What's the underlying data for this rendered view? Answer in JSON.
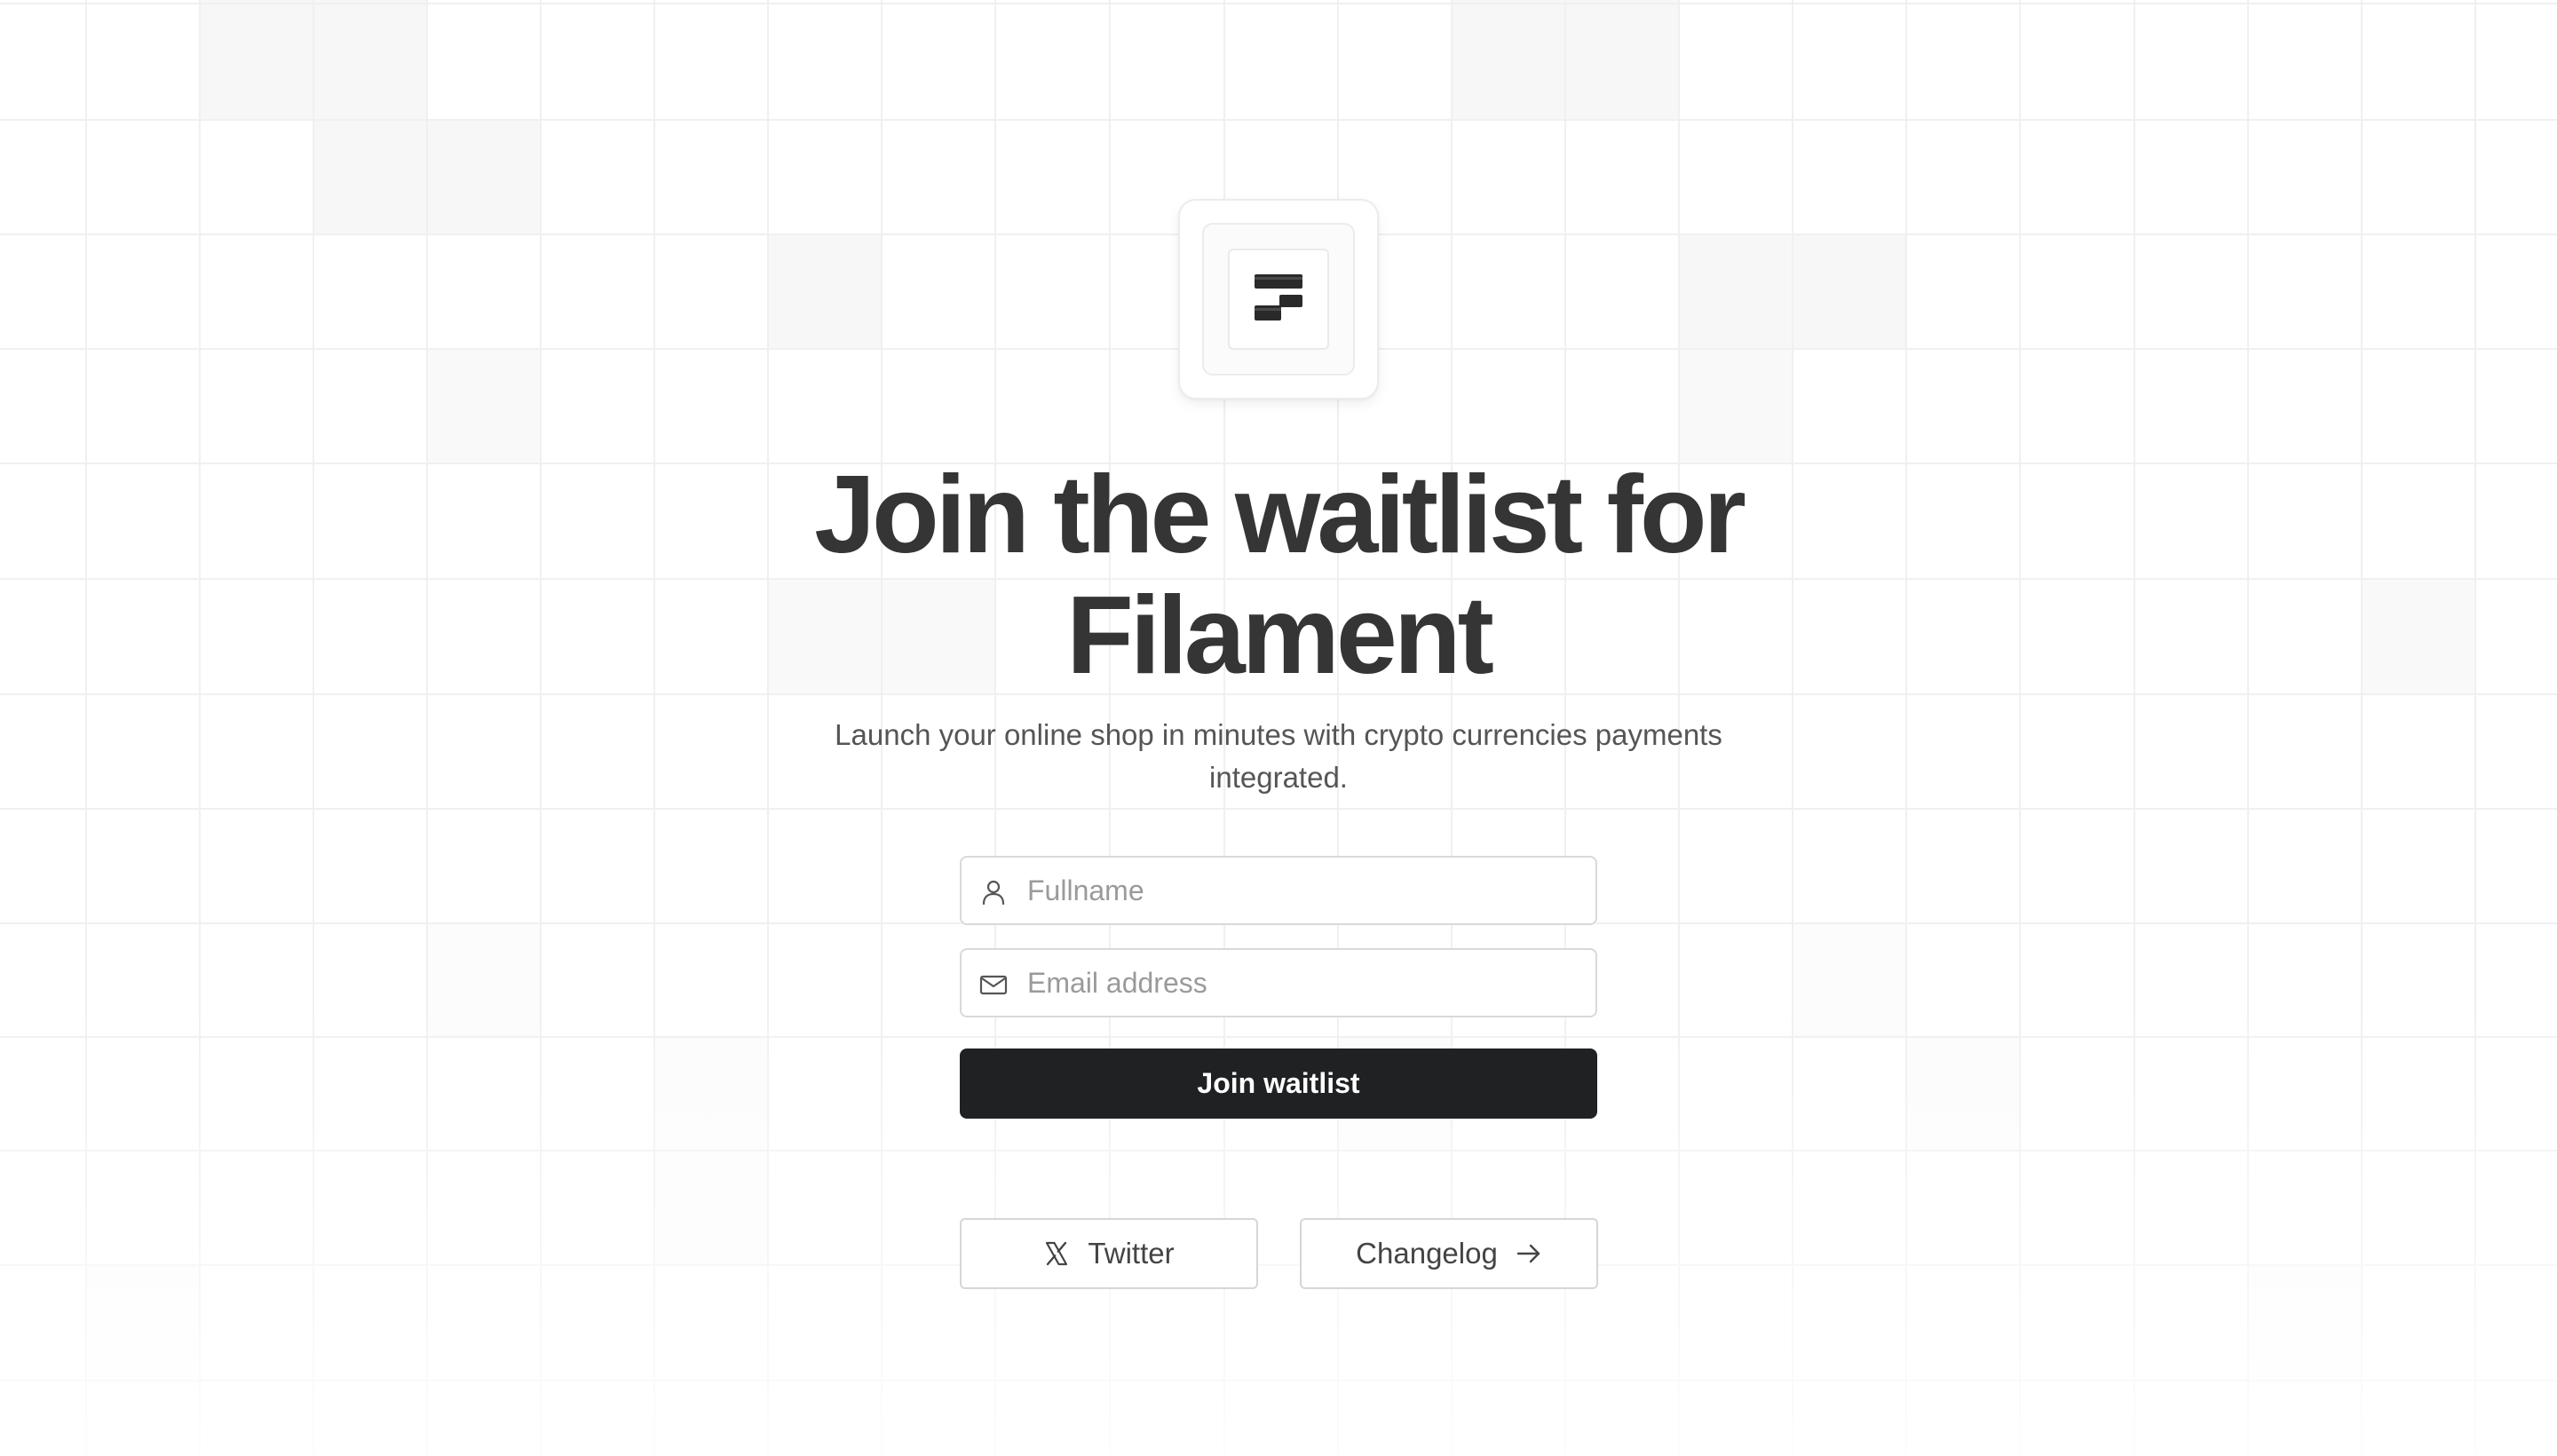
{
  "page": {
    "title": "Join the waitlist for Filament",
    "subtitle": "Launch your online shop in minutes with crypto currencies payments integrated."
  },
  "form": {
    "fullname_placeholder": "Fullname",
    "email_placeholder": "Email address",
    "submit_label": "Join waitlist"
  },
  "links": {
    "twitter_label": "Twitter",
    "changelog_label": "Changelog"
  },
  "icons": {
    "logo": "filament-logo-icon",
    "fullname": "user-icon",
    "email": "mail-icon",
    "twitter": "x-logo-icon",
    "changelog": "arrow-right-icon"
  },
  "colors": {
    "primary_button": "#202123",
    "heading": "#353535",
    "border": "#d9d9d9",
    "grid_line": "#f0f0f0"
  }
}
